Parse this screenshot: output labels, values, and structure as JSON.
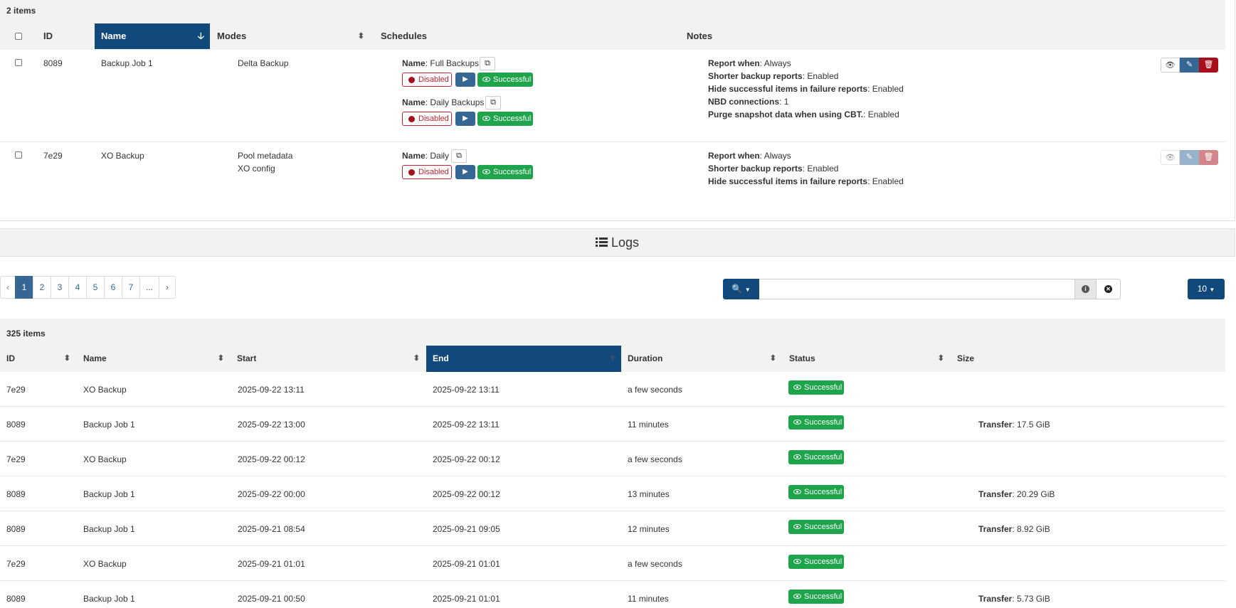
{
  "jobs": {
    "count": "2 items",
    "headers": {
      "id": "ID",
      "name": "Name",
      "modes": "Modes",
      "schedules": "Schedules",
      "notes": "Notes"
    },
    "disabled_label": "Disabled",
    "successful_label": "Successful",
    "name_prefix": "Name",
    "rows": [
      {
        "id": "8089",
        "name": "Backup Job 1",
        "modes": [
          "Delta Backup"
        ],
        "schedules": [
          {
            "name": "Full Backups"
          },
          {
            "name": "Daily Backups"
          }
        ],
        "notes": [
          {
            "k": "Report when",
            "v": "Always"
          },
          {
            "k": "Shorter backup reports",
            "v": "Enabled"
          },
          {
            "k": "Hide successful items in failure reports",
            "v": "Enabled"
          },
          {
            "k": "NBD connections",
            "v": "1"
          },
          {
            "k": "Purge snapshot data when using CBT.",
            "v": "Enabled"
          }
        ]
      },
      {
        "id": "7e29",
        "name": "XO Backup",
        "modes": [
          "Pool metadata",
          "XO config"
        ],
        "schedules": [
          {
            "name": "Daily"
          }
        ],
        "notes": [
          {
            "k": "Report when",
            "v": "Always"
          },
          {
            "k": "Shorter backup reports",
            "v": "Enabled"
          },
          {
            "k": "Hide successful items in failure reports",
            "v": "Enabled"
          }
        ]
      }
    ]
  },
  "logs": {
    "title": "Logs",
    "pages": [
      "1",
      "2",
      "3",
      "4",
      "5",
      "6",
      "7",
      "..."
    ],
    "prev": "‹",
    "next": "›",
    "search_placeholder": "",
    "per_page": "10",
    "count": "325 items",
    "headers": {
      "id": "ID",
      "name": "Name",
      "start": "Start",
      "end": "End",
      "duration": "Duration",
      "status": "Status",
      "size": "Size"
    },
    "transfer_label": "Transfer",
    "status_label": "Successful",
    "rows": [
      {
        "id": "7e29",
        "name": "XO Backup",
        "start": "2025-09-22 13:11",
        "end": "2025-09-22 13:11",
        "duration": "a few seconds",
        "size": ""
      },
      {
        "id": "8089",
        "name": "Backup Job 1",
        "start": "2025-09-22 13:00",
        "end": "2025-09-22 13:11",
        "duration": "11 minutes",
        "size": "17.5 GiB"
      },
      {
        "id": "7e29",
        "name": "XO Backup",
        "start": "2025-09-22 00:12",
        "end": "2025-09-22 00:12",
        "duration": "a few seconds",
        "size": ""
      },
      {
        "id": "8089",
        "name": "Backup Job 1",
        "start": "2025-09-22 00:00",
        "end": "2025-09-22 00:12",
        "duration": "13 minutes",
        "size": "20.29 GiB"
      },
      {
        "id": "8089",
        "name": "Backup Job 1",
        "start": "2025-09-21 08:54",
        "end": "2025-09-21 09:05",
        "duration": "12 minutes",
        "size": "8.92 GiB"
      },
      {
        "id": "7e29",
        "name": "XO Backup",
        "start": "2025-09-21 01:01",
        "end": "2025-09-21 01:01",
        "duration": "a few seconds",
        "size": ""
      },
      {
        "id": "8089",
        "name": "Backup Job 1",
        "start": "2025-09-21 00:50",
        "end": "2025-09-21 01:01",
        "duration": "11 minutes",
        "size": "5.73 GiB"
      }
    ]
  },
  "colors": {
    "primary": "#11497d",
    "success": "#1ea44a",
    "danger": "#a7101b",
    "button": "#356694"
  },
  "icons": {
    "sort": "sort-icon",
    "eye": "eye-icon",
    "play": "play-icon",
    "copy": "copy-icon",
    "edit": "pencil-icon",
    "delete": "trash-icon",
    "search": "search-icon",
    "info": "info-icon",
    "clear": "clear-icon",
    "list": "list-icon"
  }
}
